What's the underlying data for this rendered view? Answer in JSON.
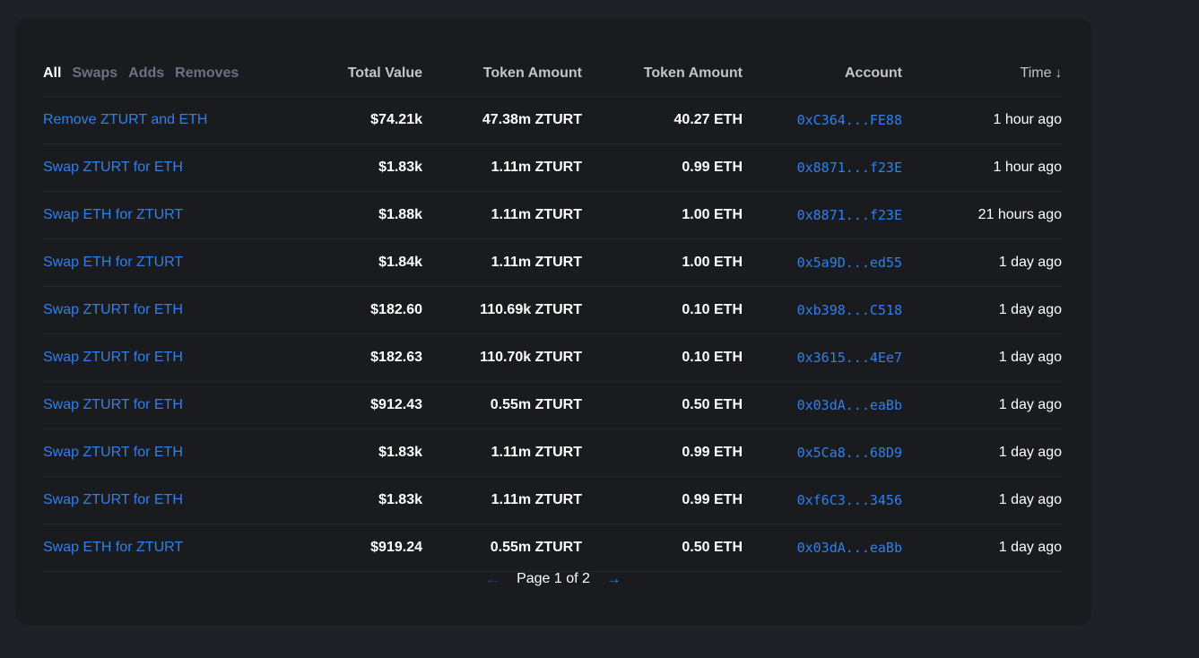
{
  "filters": {
    "all": "All",
    "swaps": "Swaps",
    "adds": "Adds",
    "removes": "Removes"
  },
  "columns": {
    "total_value": "Total Value",
    "token_amount_1": "Token Amount",
    "token_amount_2": "Token Amount",
    "account": "Account",
    "time": "Time",
    "time_sort_icon": "↓"
  },
  "rows": [
    {
      "action": "Remove ZTURT and ETH",
      "total": "$74.21k",
      "token1": "47.38m ZTURT",
      "token2": "40.27 ETH",
      "account": "0xC364...FE88",
      "time": "1 hour ago"
    },
    {
      "action": "Swap ZTURT for ETH",
      "total": "$1.83k",
      "token1": "1.11m ZTURT",
      "token2": "0.99 ETH",
      "account": "0x8871...f23E",
      "time": "1 hour ago"
    },
    {
      "action": "Swap ETH for ZTURT",
      "total": "$1.88k",
      "token1": "1.11m ZTURT",
      "token2": "1.00 ETH",
      "account": "0x8871...f23E",
      "time": "21 hours ago"
    },
    {
      "action": "Swap ETH for ZTURT",
      "total": "$1.84k",
      "token1": "1.11m ZTURT",
      "token2": "1.00 ETH",
      "account": "0x5a9D...ed55",
      "time": "1 day ago"
    },
    {
      "action": "Swap ZTURT for ETH",
      "total": "$182.60",
      "token1": "110.69k ZTURT",
      "token2": "0.10 ETH",
      "account": "0xb398...C518",
      "time": "1 day ago"
    },
    {
      "action": "Swap ZTURT for ETH",
      "total": "$182.63",
      "token1": "110.70k ZTURT",
      "token2": "0.10 ETH",
      "account": "0x3615...4Ee7",
      "time": "1 day ago"
    },
    {
      "action": "Swap ZTURT for ETH",
      "total": "$912.43",
      "token1": "0.55m ZTURT",
      "token2": "0.50 ETH",
      "account": "0x03dA...eaBb",
      "time": "1 day ago"
    },
    {
      "action": "Swap ZTURT for ETH",
      "total": "$1.83k",
      "token1": "1.11m ZTURT",
      "token2": "0.99 ETH",
      "account": "0x5Ca8...68D9",
      "time": "1 day ago"
    },
    {
      "action": "Swap ZTURT for ETH",
      "total": "$1.83k",
      "token1": "1.11m ZTURT",
      "token2": "0.99 ETH",
      "account": "0xf6C3...3456",
      "time": "1 day ago"
    },
    {
      "action": "Swap ETH for ZTURT",
      "total": "$919.24",
      "token1": "0.55m ZTURT",
      "token2": "0.50 ETH",
      "account": "0x03dA...eaBb",
      "time": "1 day ago"
    }
  ],
  "pagination": {
    "prev_icon": "←",
    "label": "Page 1 of 2",
    "next_icon": "→"
  },
  "colors": {
    "background": "#1f2128",
    "panel": "#191b1f",
    "link": "#2f80ed",
    "muted": "#6c7284"
  }
}
